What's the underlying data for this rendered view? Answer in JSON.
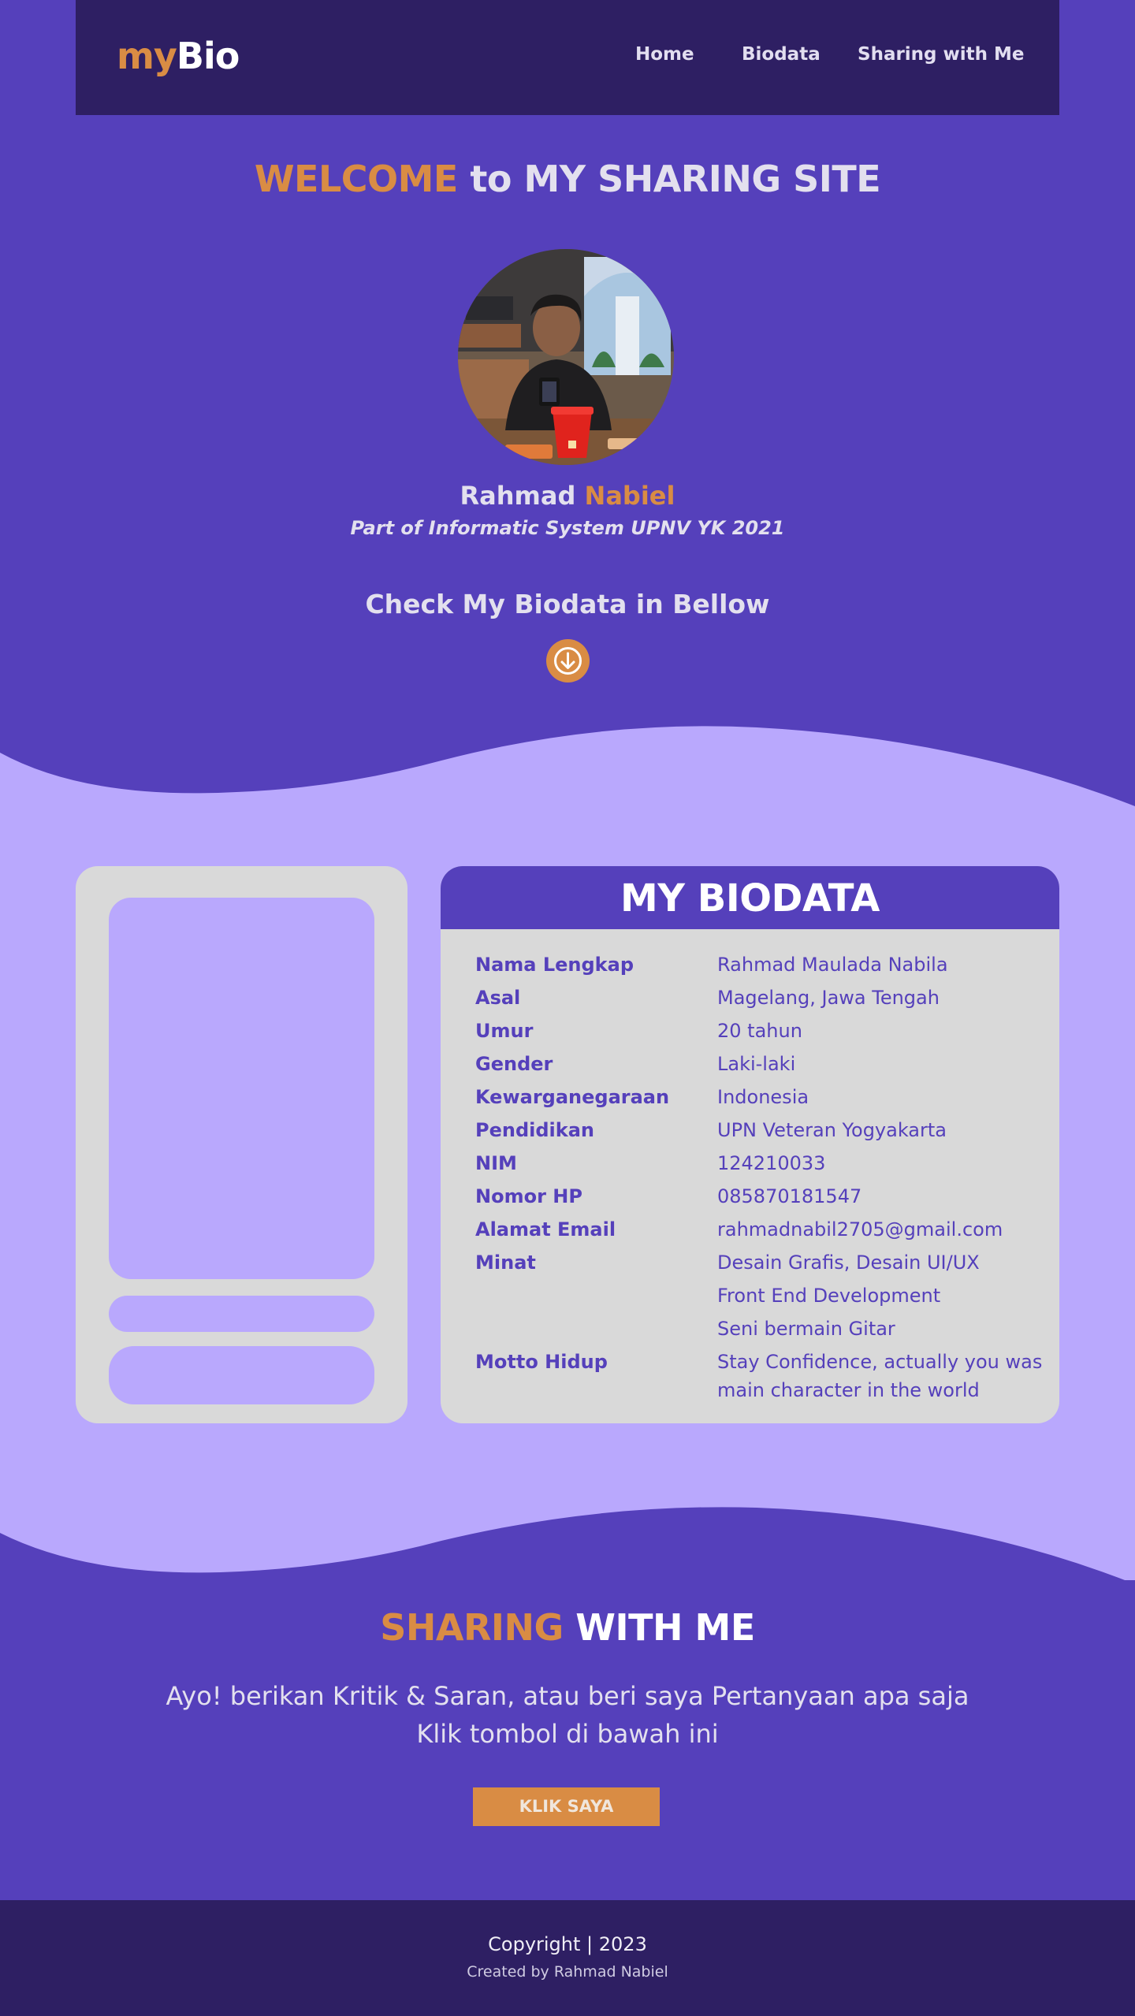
{
  "nav": {
    "logo_part1": "my",
    "logo_part2": "Bio",
    "links": [
      "Home",
      "Biodata",
      "Sharing with Me"
    ]
  },
  "hero": {
    "title_accent": "WELCOME",
    "title_rest": " to MY SHARING SITE",
    "first_name": "Rahmad ",
    "last_name": "Nabiel",
    "subtitle": "Part of Informatic System UPNV YK 2021",
    "check_text": "Check My Biodata in Bellow",
    "scroll_icon": "arrow-down-circle-icon"
  },
  "biodata": {
    "title": "MY BIODATA",
    "rows": [
      {
        "key": "Nama Lengkap",
        "value": "Rahmad Maulada Nabila"
      },
      {
        "key": "Asal",
        "value": "Magelang, Jawa Tengah"
      },
      {
        "key": "Umur",
        "value": "20 tahun"
      },
      {
        "key": "Gender",
        "value": "Laki-laki"
      },
      {
        "key": "Kewarganegaraan",
        "value": "Indonesia"
      },
      {
        "key": "Pendidikan",
        "value": "UPN Veteran Yogyakarta"
      },
      {
        "key": "NIM",
        "value": "124210033"
      },
      {
        "key": "Nomor HP",
        "value": "085870181547"
      },
      {
        "key": "Alamat Email",
        "value": "rahmadnabil2705@gmail.com"
      },
      {
        "key": "Minat",
        "value": "Desain Grafis, Desain UI/UX"
      },
      {
        "key": "",
        "value": "Front End Development"
      },
      {
        "key": "",
        "value": "Seni bermain Gitar"
      },
      {
        "key": "Motto Hidup",
        "value": "Stay Confidence, actually you was main character in the world"
      }
    ]
  },
  "sharing": {
    "title_accent": "SHARING",
    "title_rest": " WITH ME",
    "line1": "Ayo! berikan Kritik & Saran, atau beri saya Pertanyaan apa saja",
    "line2": "Klik tombol di bawah ini",
    "button": "KLIK SAYA"
  },
  "footer": {
    "copyright": "Copyright | 2023",
    "credit": "Created by Rahmad Nabiel"
  },
  "colors": {
    "primary": "#5540bb",
    "dark": "#2e1f63",
    "accent": "#d98c44",
    "light": "#b9a8fd",
    "card": "#d9d9d9"
  }
}
